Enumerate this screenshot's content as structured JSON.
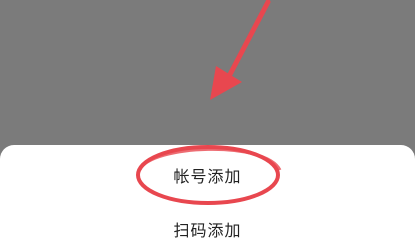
{
  "menu": {
    "items": [
      {
        "label": "帐号添加"
      },
      {
        "label": "扫码添加"
      }
    ]
  },
  "colors": {
    "overlay": "#7b7b7b",
    "sheet": "#ffffff",
    "text": "#222222",
    "annotation": "#e8474f"
  },
  "annotation": {
    "arrow_icon": "arrow-pointer-icon",
    "highlight_icon": "circle-highlight-icon"
  }
}
